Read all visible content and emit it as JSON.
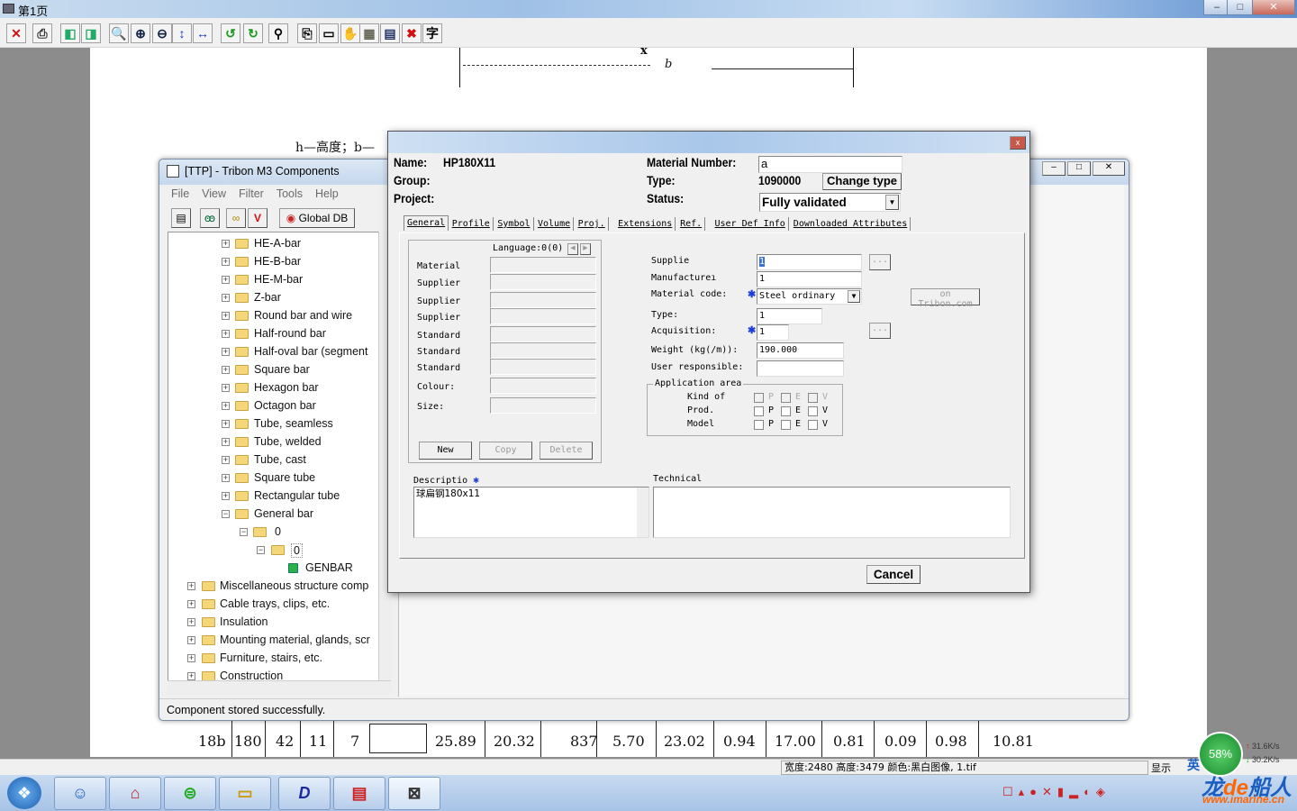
{
  "viewer": {
    "title": "第1页",
    "window_buttons": [
      "–",
      "□",
      "✕"
    ],
    "toolbar": [
      {
        "icon": "close-icon",
        "g": "✕",
        "c": "#d01010"
      },
      {
        "icon": "print-icon",
        "g": "⎙",
        "c": "#333"
      },
      {
        "icon": "prev-page-icon",
        "g": "◧",
        "c": "#2a6"
      },
      {
        "icon": "next-page-icon",
        "g": "◨",
        "c": "#2a6"
      },
      {
        "icon": "zoom-icon",
        "g": "🔍",
        "c": "#236"
      },
      {
        "icon": "zoom-in-icon",
        "g": "⊕",
        "c": "#124"
      },
      {
        "icon": "zoom-out-icon",
        "g": "⊖",
        "c": "#124"
      },
      {
        "icon": "fit-height-icon",
        "g": "↕",
        "c": "#1636c0"
      },
      {
        "icon": "fit-width-icon",
        "g": "↔",
        "c": "#1636c0"
      },
      {
        "icon": "rotate-left-icon",
        "g": "↺",
        "c": "#1a9c1a"
      },
      {
        "icon": "rotate-right-icon",
        "g": "↻",
        "c": "#1a9c1a"
      },
      {
        "icon": "find-icon",
        "g": "⚲",
        "c": "#000"
      },
      {
        "icon": "copy-icon",
        "g": "⎘",
        "c": "#000"
      },
      {
        "icon": "select-icon",
        "g": "▭",
        "c": "#000"
      },
      {
        "icon": "hand-icon",
        "g": "✋",
        "c": "#aaa"
      },
      {
        "icon": "thumbnails-icon",
        "g": "▦",
        "c": "#665"
      },
      {
        "icon": "layout-icon",
        "g": "▤",
        "c": "#236"
      },
      {
        "icon": "delete-grid-icon",
        "g": "✖",
        "c": "#d01010"
      },
      {
        "icon": "ocr-icon",
        "g": "字",
        "c": "#000"
      }
    ],
    "status": "宽度:2480  高度:3479  颜色:黑白图像,  1.tif",
    "status_right": "显示"
  },
  "document": {
    "dim_x": "x",
    "dim_b": "b",
    "legend": "h—高度；b—",
    "row": [
      "18b",
      "180",
      "42",
      "11",
      "7",
      "",
      "25.89",
      "20.32",
      "837",
      "5.70",
      "23.02",
      "0.94",
      "17.00",
      "0.81",
      "0.09",
      "0.98",
      "10.81"
    ]
  },
  "tribon": {
    "title": "[TTP] - Tribon M3 Components",
    "menu": [
      "File",
      "View",
      "Filter",
      "Tools",
      "Help"
    ],
    "global_db": "Global DB",
    "status": "Component stored successfully.",
    "tree": [
      {
        "l": 2,
        "t": "HE-A-bar"
      },
      {
        "l": 2,
        "t": "HE-B-bar"
      },
      {
        "l": 2,
        "t": "HE-M-bar"
      },
      {
        "l": 2,
        "t": "Z-bar"
      },
      {
        "l": 2,
        "t": "Round bar and wire"
      },
      {
        "l": 2,
        "t": "Half-round bar"
      },
      {
        "l": 2,
        "t": "Half-oval bar (segment"
      },
      {
        "l": 2,
        "t": "Square bar"
      },
      {
        "l": 2,
        "t": "Hexagon bar"
      },
      {
        "l": 2,
        "t": "Octagon bar"
      },
      {
        "l": 2,
        "t": "Tube, seamless"
      },
      {
        "l": 2,
        "t": "Tube, welded"
      },
      {
        "l": 2,
        "t": "Tube, cast"
      },
      {
        "l": 2,
        "t": "Square tube"
      },
      {
        "l": 2,
        "t": "Rectangular tube"
      },
      {
        "l": 2,
        "t": "General bar",
        "open": true
      },
      {
        "l": 3,
        "t": "0",
        "open": true
      },
      {
        "l": 4,
        "t": "0",
        "open": true,
        "sel": true
      },
      {
        "l": 5,
        "t": "GENBAR",
        "leaf": true
      },
      {
        "l": 0,
        "t": "Miscellaneous structure comp"
      },
      {
        "l": 0,
        "t": "Cable trays, clips, etc."
      },
      {
        "l": 0,
        "t": "Insulation"
      },
      {
        "l": 0,
        "t": "Mounting material, glands, scr"
      },
      {
        "l": 0,
        "t": "Furniture, stairs, etc."
      },
      {
        "l": 0,
        "t": "Construction"
      }
    ]
  },
  "dialog": {
    "name_label": "Name:",
    "name": "HP180X11",
    "group_label": "Group:",
    "project_label": "Project:",
    "matnum_label": "Material Number:",
    "matnum": "a",
    "type_label": "Type:",
    "type": "1090000",
    "change_type": "Change type",
    "status_label": "Status:",
    "status": "Fully validated",
    "tabs": [
      "General",
      "Profile",
      "Symbol",
      "Volume",
      "Proj.",
      "Extensions",
      "Ref.",
      "User Def Info",
      "Downloaded Attributes"
    ],
    "language": "Language:0(0)",
    "left_fields": [
      "Material",
      "Supplier",
      "Supplier",
      "Supplier",
      "Standard",
      "Standard",
      "Standard",
      "Colour:",
      "Size:"
    ],
    "new": "New",
    "copy": "Copy",
    "delete": "Delete",
    "right": {
      "supplier_label": "Supplie",
      "supplier": "1",
      "manufacturer_label": "Manufactureı",
      "manufacturer": "1",
      "material_code_label": "Material code:",
      "material_code": "Steel ordinary",
      "type_label": "Type:",
      "type": "1",
      "acquisition_label": "Acquisition:",
      "acquisition": "1",
      "weight_label": "Weight (kg(/m)):",
      "weight": "190.000",
      "user_label": "User responsible:",
      "user": "",
      "browse": "...",
      "tribon_link": "on Tribon.com"
    },
    "app_area": {
      "title": "Application area",
      "rows": [
        "Kind of",
        "Prod.",
        "Model"
      ],
      "cols": [
        "P",
        "E",
        "V"
      ]
    },
    "description_label": "Descriptio",
    "description": "球扁钢180x11",
    "technical_label": "Technical",
    "cancel": "Cancel"
  },
  "tray": {
    "percent": "58%",
    "up": "31.6K/s",
    "down": "30.2K/s",
    "ime": "英",
    "watermark": "龙de船人",
    "watermark_url": "www.imarine.cn"
  }
}
